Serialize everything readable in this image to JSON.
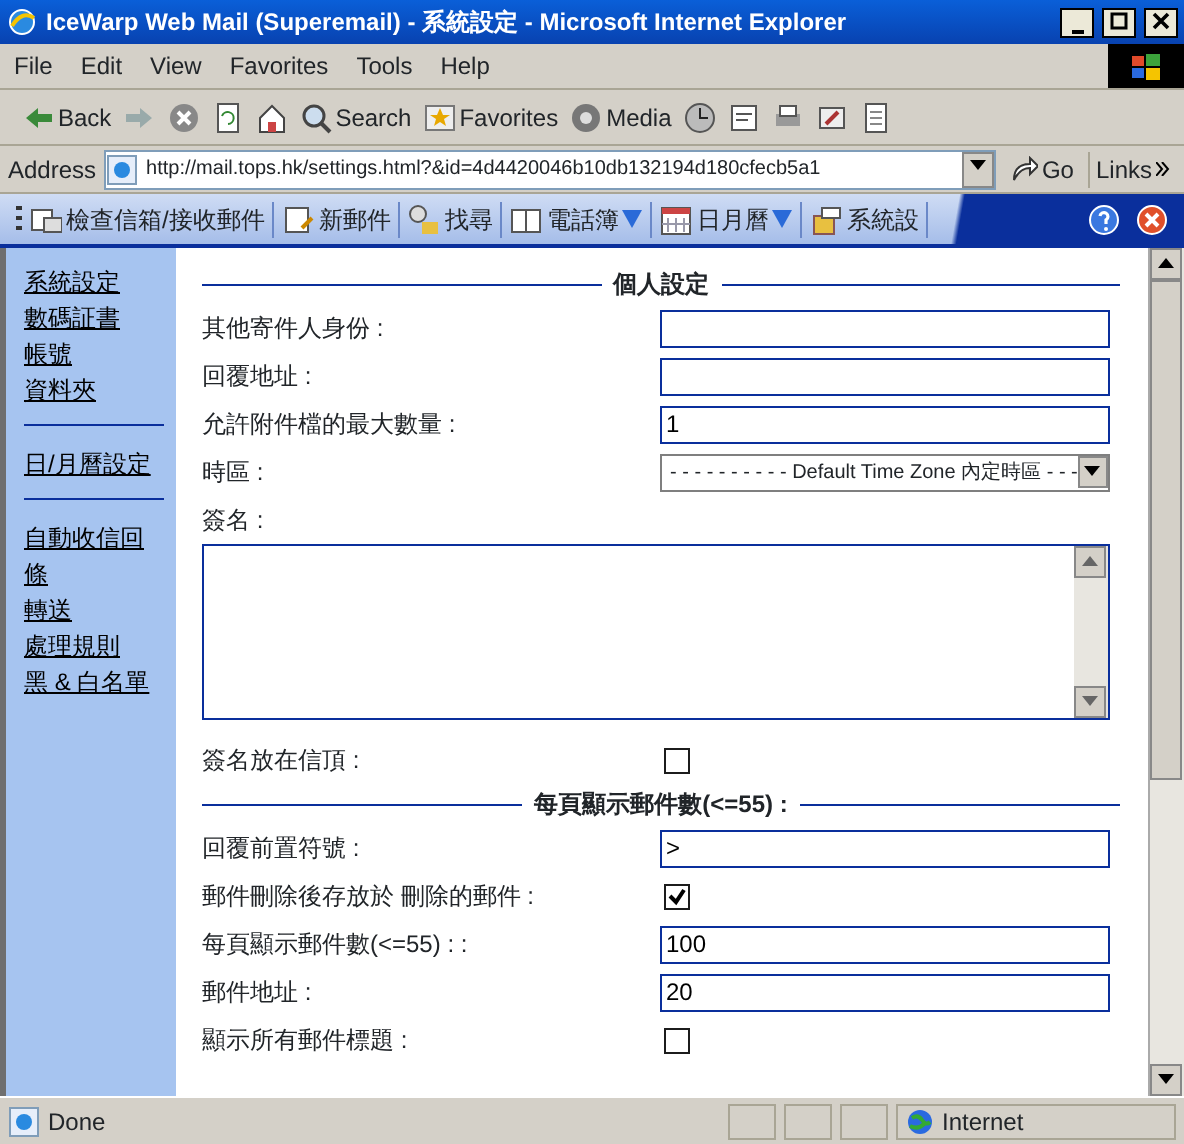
{
  "window": {
    "title": "IceWarp Web Mail (Superemail) - 系統設定 - Microsoft Internet Explorer"
  },
  "menu": [
    "File",
    "Edit",
    "View",
    "Favorites",
    "Tools",
    "Help"
  ],
  "toolbar": [
    {
      "kind": "back",
      "label": "Back"
    },
    {
      "kind": "forward"
    },
    {
      "kind": "stop"
    },
    {
      "kind": "refresh"
    },
    {
      "kind": "home"
    },
    {
      "kind": "search",
      "label": "Search"
    },
    {
      "kind": "favorites",
      "label": "Favorites"
    },
    {
      "kind": "media",
      "label": "Media"
    },
    {
      "kind": "history"
    },
    {
      "kind": "mail"
    },
    {
      "kind": "print"
    },
    {
      "kind": "edit"
    },
    {
      "kind": "discuss"
    }
  ],
  "address": {
    "label": "Address",
    "value": "http://mail.tops.hk/settings.html?&id=4d4420046b10db132194d180cfecb5a1",
    "go": "Go",
    "links": "Links"
  },
  "app_toolbar": [
    {
      "label": "檢查信箱/接收郵件",
      "dropdown": false
    },
    {
      "label": "新郵件",
      "dropdown": false
    },
    {
      "label": "找尋",
      "dropdown": false
    },
    {
      "label": "電話簿",
      "dropdown": true
    },
    {
      "label": "日月曆",
      "dropdown": true
    },
    {
      "label": "系統設",
      "dropdown": false
    }
  ],
  "sidebar": [
    [
      "系統設定",
      "數碼証書",
      "帳號",
      "資料夾"
    ],
    [
      "日/月曆設定"
    ],
    [
      "自動收信回條",
      "轉送",
      "處理規則",
      "黑 & 白名單"
    ]
  ],
  "sections": [
    {
      "heading": "個人設定",
      "rows": [
        {
          "kind": "text",
          "label": "其他寄件人身份 :"
        },
        {
          "kind": "text",
          "label": "回覆地址 :"
        },
        {
          "kind": "text",
          "label": "允許附件檔的最大數量 :",
          "value": "1"
        },
        {
          "kind": "select",
          "label": "時區 :",
          "value": "- - - - - - - - - - Default Time Zone 內定時區 - - -"
        },
        {
          "kind": "textarea",
          "label": "簽名 :"
        },
        {
          "kind": "checkbox",
          "label": "簽名放在信頂 :",
          "checked": false
        }
      ]
    },
    {
      "heading": "每頁顯示郵件數(<=55) :",
      "rows": [
        {
          "kind": "text",
          "label": "回覆前置符號 :",
          "value": ">"
        },
        {
          "kind": "checkbox",
          "label": "郵件刪除後存放於 刪除的郵件 :",
          "checked": true
        },
        {
          "kind": "text",
          "label": "每頁顯示郵件數(<=55) : :",
          "value": "100"
        },
        {
          "kind": "text",
          "label": "郵件地址 :",
          "value": "20"
        },
        {
          "kind": "checkbox",
          "label": "顯示所有郵件標題 :",
          "checked": false
        }
      ]
    }
  ],
  "status": {
    "text": "Done",
    "zone": "Internet"
  }
}
